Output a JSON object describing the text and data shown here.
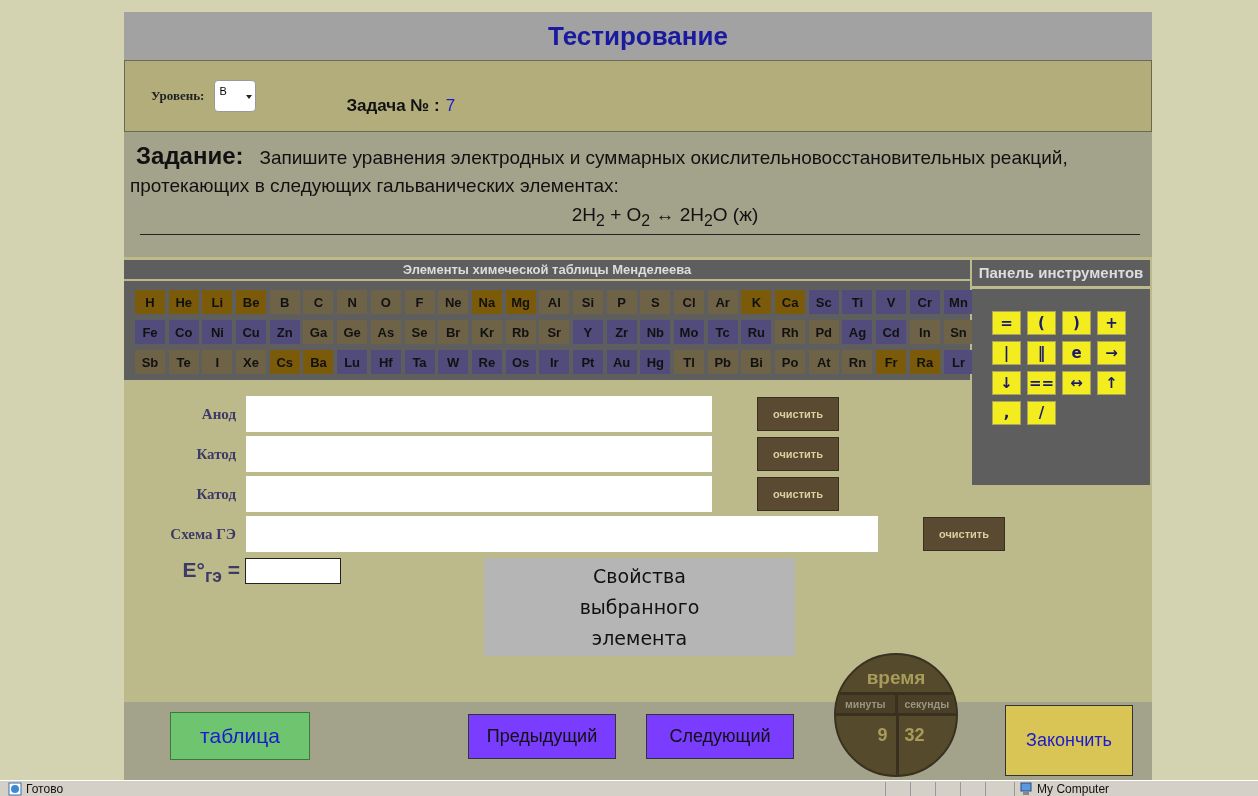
{
  "header": {
    "title": "Тестирование"
  },
  "level": {
    "label": "Уровень:",
    "value": "B"
  },
  "task_number": {
    "label": "Задача № :",
    "value": "7"
  },
  "task": {
    "label": "Задание:",
    "text": "Запишите уравнения электродных и суммарных окислительновосстановительных реакций, протекающих  в следующих гальванических элементах:",
    "equation": "2H$_{2}$ + O$_{2}$ ↔ 2H$_{2}$O (ж)"
  },
  "periodic_table": {
    "title": "Элементы химеческой таблицы Менделеева",
    "rows": [
      [
        {
          "symbol": "H",
          "color": "#7b5a0a"
        },
        {
          "symbol": "He",
          "color": "#7b5a0a"
        },
        {
          "symbol": "Li",
          "color": "#7b5a0a"
        },
        {
          "symbol": "Be",
          "color": "#7b5a0a"
        },
        {
          "symbol": "B",
          "color": "#6f6347"
        },
        {
          "symbol": "C",
          "color": "#6f6347"
        },
        {
          "symbol": "N",
          "color": "#6f6347"
        },
        {
          "symbol": "O",
          "color": "#6f6347"
        },
        {
          "symbol": "F",
          "color": "#6f6347"
        },
        {
          "symbol": "Ne",
          "color": "#6f6347"
        },
        {
          "symbol": "Na",
          "color": "#7b5a0a"
        },
        {
          "symbol": "Mg",
          "color": "#7b5a0a"
        },
        {
          "symbol": "Al",
          "color": "#6f6347"
        },
        {
          "symbol": "Si",
          "color": "#6f6347"
        },
        {
          "symbol": "P",
          "color": "#6f6347"
        },
        {
          "symbol": "S",
          "color": "#6f6347"
        },
        {
          "symbol": "Cl",
          "color": "#6f6347"
        },
        {
          "symbol": "Ar",
          "color": "#6f6347"
        },
        {
          "symbol": "K",
          "color": "#7b5a0a"
        },
        {
          "symbol": "Ca",
          "color": "#7b5a0a"
        },
        {
          "symbol": "Sc",
          "color": "#514c7c"
        },
        {
          "symbol": "Ti",
          "color": "#514c7c"
        },
        {
          "symbol": "V",
          "color": "#514c7c"
        },
        {
          "symbol": "Cr",
          "color": "#514c7c"
        },
        {
          "symbol": "Mn",
          "color": "#514c7c"
        }
      ],
      [
        {
          "symbol": "Fe",
          "color": "#514c7c"
        },
        {
          "symbol": "Co",
          "color": "#514c7c"
        },
        {
          "symbol": "Ni",
          "color": "#514c7c"
        },
        {
          "symbol": "Cu",
          "color": "#514c7c"
        },
        {
          "symbol": "Zn",
          "color": "#514c7c"
        },
        {
          "symbol": "Ga",
          "color": "#6f6347"
        },
        {
          "symbol": "Ge",
          "color": "#6f6347"
        },
        {
          "symbol": "As",
          "color": "#6f6347"
        },
        {
          "symbol": "Se",
          "color": "#6f6347"
        },
        {
          "symbol": "Br",
          "color": "#6f6347"
        },
        {
          "symbol": "Kr",
          "color": "#6f6347"
        },
        {
          "symbol": "Rb",
          "color": "#6f6347"
        },
        {
          "symbol": "Sr",
          "color": "#6f6347"
        },
        {
          "symbol": "Y",
          "color": "#514c7c"
        },
        {
          "symbol": "Zr",
          "color": "#514c7c"
        },
        {
          "symbol": "Nb",
          "color": "#514c7c"
        },
        {
          "symbol": "Mo",
          "color": "#514c7c"
        },
        {
          "symbol": "Tc",
          "color": "#514c7c"
        },
        {
          "symbol": "Ru",
          "color": "#514c7c"
        },
        {
          "symbol": "Rh",
          "color": "#6f6347"
        },
        {
          "symbol": "Pd",
          "color": "#6f6347"
        },
        {
          "symbol": "Ag",
          "color": "#514c7c"
        },
        {
          "symbol": "Cd",
          "color": "#514c7c"
        },
        {
          "symbol": "In",
          "color": "#6f6347"
        },
        {
          "symbol": "Sn",
          "color": "#6f6347"
        }
      ],
      [
        {
          "symbol": "Sb",
          "color": "#6f6347"
        },
        {
          "symbol": "Te",
          "color": "#6f6347"
        },
        {
          "symbol": "I",
          "color": "#6f6347"
        },
        {
          "symbol": "Xe",
          "color": "#6f6347"
        },
        {
          "symbol": "Cs",
          "color": "#7b5a0a"
        },
        {
          "symbol": "Ba",
          "color": "#7b5a0a"
        },
        {
          "symbol": "Lu",
          "color": "#514c7c"
        },
        {
          "symbol": "Hf",
          "color": "#514c7c"
        },
        {
          "symbol": "Ta",
          "color": "#514c7c"
        },
        {
          "symbol": "W",
          "color": "#514c7c"
        },
        {
          "symbol": "Re",
          "color": "#514c7c"
        },
        {
          "symbol": "Os",
          "color": "#514c7c"
        },
        {
          "symbol": "Ir",
          "color": "#514c7c"
        },
        {
          "symbol": "Pt",
          "color": "#514c7c"
        },
        {
          "symbol": "Au",
          "color": "#514c7c"
        },
        {
          "symbol": "Hg",
          "color": "#514c7c"
        },
        {
          "symbol": "Tl",
          "color": "#6f6347"
        },
        {
          "symbol": "Pb",
          "color": "#6f6347"
        },
        {
          "symbol": "Bi",
          "color": "#6f6347"
        },
        {
          "symbol": "Po",
          "color": "#6f6347"
        },
        {
          "symbol": "At",
          "color": "#6f6347"
        },
        {
          "symbol": "Rn",
          "color": "#6f6347"
        },
        {
          "symbol": "Fr",
          "color": "#7b5a0a"
        },
        {
          "symbol": "Ra",
          "color": "#7b5a0a"
        },
        {
          "symbol": "Lr",
          "color": "#514c7c"
        }
      ]
    ]
  },
  "tool_panel": {
    "title": "Панель инструментов",
    "keys": [
      "=",
      "(",
      ")",
      "+",
      "|",
      "‖",
      "e",
      "→",
      "↓",
      "==",
      "↔",
      "↑",
      ",",
      "/"
    ]
  },
  "fields": [
    {
      "label": "Анод",
      "button": "очистить",
      "kind": "short"
    },
    {
      "label": "Катод",
      "button": "очистить",
      "kind": "short"
    },
    {
      "label": "Катод",
      "button": "очистить",
      "kind": "short"
    },
    {
      "label": "Схема ГЭ",
      "button": "очистить",
      "kind": "wide"
    }
  ],
  "potential": {
    "label": "E°$_{гэ}$ ="
  },
  "properties_box": {
    "text": "Свойства выбранного элемента"
  },
  "timer": {
    "title": "время",
    "minutes_label": "минуты",
    "seconds_label": "секунды",
    "minutes": "9",
    "seconds": "32"
  },
  "buttons": [
    {
      "label": "таблица",
      "kind": "table"
    },
    {
      "label": "Предыдущий",
      "kind": "prev"
    },
    {
      "label": "Следующий",
      "kind": "next"
    },
    {
      "label": "Закончить",
      "kind": "finish"
    }
  ],
  "status_bar": {
    "text": "Готово",
    "zone": "My Computer"
  }
}
